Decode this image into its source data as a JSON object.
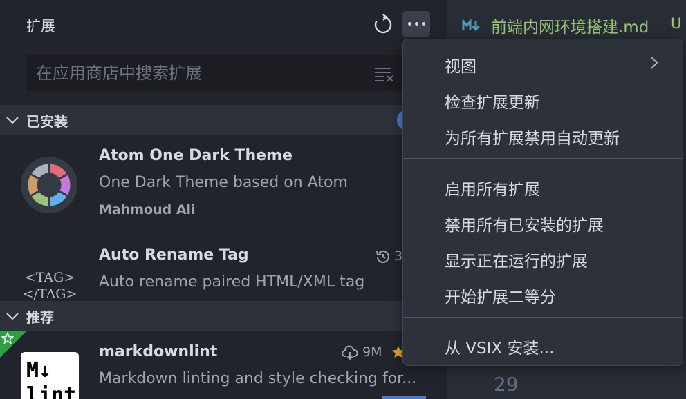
{
  "sidebar": {
    "title": "扩展",
    "search_placeholder": "在应用商店中搜索扩展",
    "sections": {
      "installed": "已安装",
      "recommended": "推荐"
    },
    "extensions": [
      {
        "name": "Atom One Dark Theme",
        "description": "One Dark Theme based on Atom",
        "publisher": "Mahmoud Ali"
      },
      {
        "name": "Auto Rename Tag",
        "description": "Auto rename paired HTML/XML tag",
        "stat": "3",
        "tag_logo_lines": [
          "<TAG>",
          "</TAG>"
        ]
      },
      {
        "name": "markdownlint",
        "description": "Markdown linting and style checking for...",
        "downloads": "9M",
        "logo_lines": [
          "M↓",
          "lint"
        ]
      }
    ]
  },
  "editor": {
    "tab_name": "前端内网环境搭建.md",
    "tab_status": "U",
    "line_number": "29"
  },
  "menu": {
    "group1": [
      "视图",
      "检查扩展更新",
      "为所有扩展禁用自动更新"
    ],
    "group2": [
      "启用所有扩展",
      "禁用所有已安装的扩展",
      "显示正在运行的扩展",
      "开始扩展二等分"
    ],
    "group3": [
      "从 VSIX 安装..."
    ]
  },
  "colors": {
    "sidebar_bg": "#21252b",
    "menu_bg": "#2c313a",
    "accent_green": "#98c379",
    "badge_blue": "#4d78cc",
    "recommend_green": "#2ea043"
  }
}
